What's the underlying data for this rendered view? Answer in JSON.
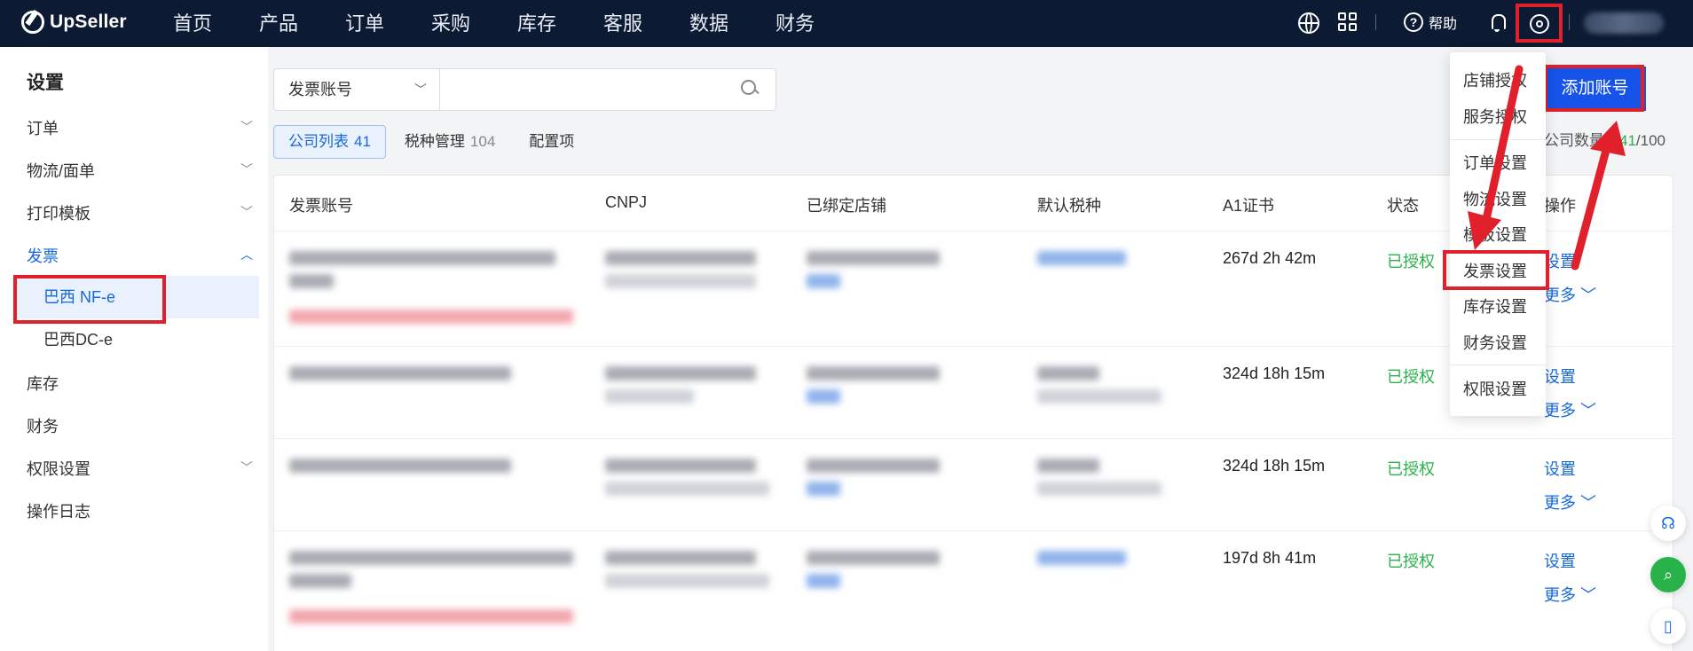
{
  "brand": {
    "name": "UpSeller"
  },
  "nav": {
    "items": [
      "首页",
      "产品",
      "订单",
      "采购",
      "库存",
      "客服",
      "数据",
      "财务"
    ]
  },
  "topbar": {
    "help_label": "帮助"
  },
  "sidebar": {
    "title": "设置",
    "items": [
      {
        "label": "订单",
        "chevron": "﹀"
      },
      {
        "label": "物流/面单",
        "chevron": "﹀"
      },
      {
        "label": "打印模板",
        "chevron": "﹀"
      },
      {
        "label": "发票",
        "chevron": "︿"
      },
      {
        "label": "库存"
      },
      {
        "label": "财务"
      },
      {
        "label": "权限设置",
        "chevron": "﹀"
      },
      {
        "label": "操作日志"
      }
    ],
    "sub_items": [
      "巴西 NF-e",
      "巴西DC-e"
    ]
  },
  "search": {
    "select_value": "发票账号",
    "select_chevron": "﹀",
    "input_value": ""
  },
  "tabs": [
    {
      "label": "公司列表",
      "count": "41"
    },
    {
      "label": "税种管理",
      "count": "104"
    },
    {
      "label": "配置项",
      "count": ""
    }
  ],
  "actions": {
    "add_account": "添加账号"
  },
  "company_count": {
    "label": "公司数量：",
    "current": "41",
    "total": "/100"
  },
  "table": {
    "headers": [
      "发票账号",
      "CNPJ",
      "已绑定店铺",
      "默认税种",
      "A1证书",
      "状态",
      "操作"
    ],
    "rows": [
      {
        "cert": "267d 2h 42m",
        "status": "已授权",
        "action": "设置",
        "more": "更多 ﹀"
      },
      {
        "cert": "324d 18h 15m",
        "status": "已授权",
        "action": "设置",
        "more": "更多 ﹀"
      },
      {
        "cert": "324d 18h 15m",
        "status": "已授权",
        "action": "设置",
        "more": "更多 ﹀"
      },
      {
        "cert": "197d 8h 41m",
        "status": "已授权",
        "action": "设置",
        "more": "更多 ﹀"
      }
    ]
  },
  "settings_menu": {
    "items": [
      "店铺授权",
      "服务授权",
      "订单设置",
      "物流设置",
      "模板设置",
      "发票设置",
      "库存设置",
      "财务设置",
      "权限设置"
    ]
  },
  "colors": {
    "topbar": "#0c1a33",
    "primary": "#1668dc",
    "button": "#1653e8",
    "success": "#2ab24a",
    "highlight": "#e0202a"
  }
}
